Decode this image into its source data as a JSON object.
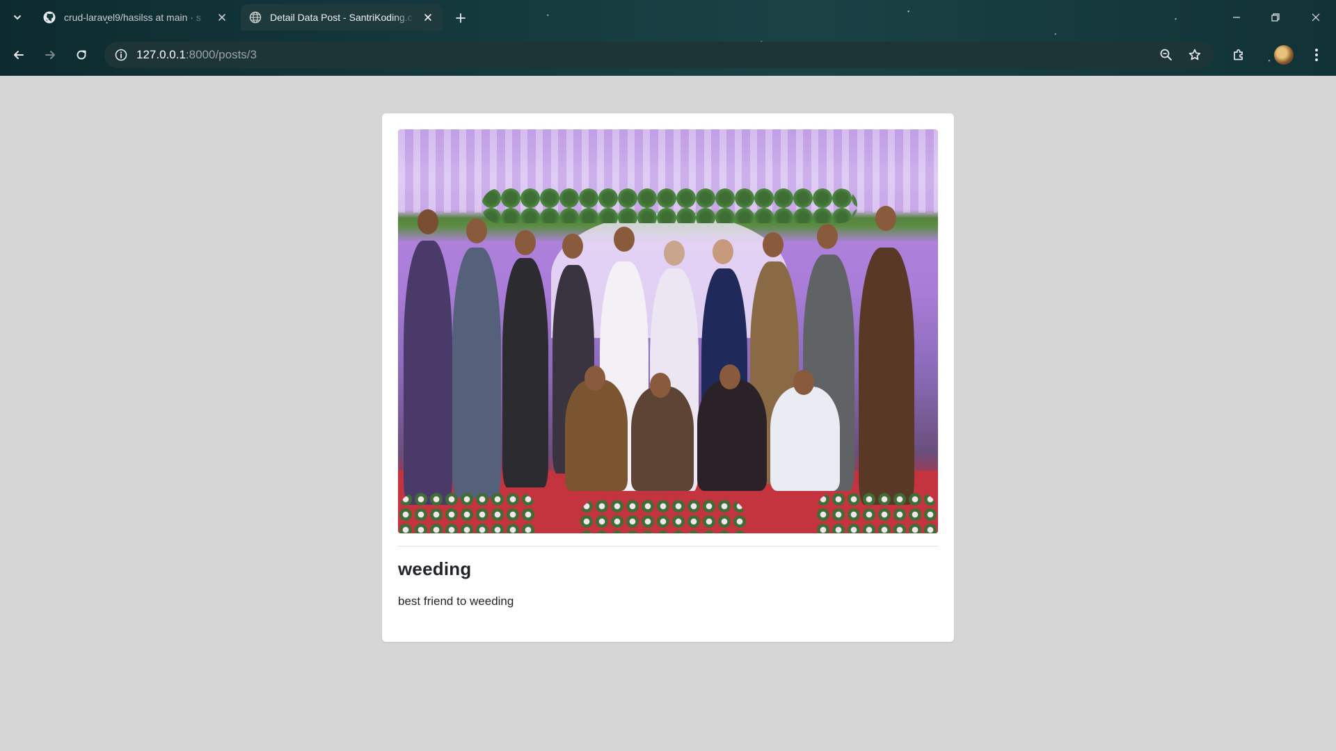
{
  "browser": {
    "tabs": [
      {
        "title": "crud-laravel9/hasilss at main · s",
        "favicon": "github-icon",
        "active": false
      },
      {
        "title": "Detail Data Post - SantriKoding.c",
        "favicon": "globe-icon",
        "active": true
      }
    ],
    "address": {
      "host": "127.0.0.1",
      "path": ":8000/posts/3"
    }
  },
  "post": {
    "image_alt": "Group photo at a wedding",
    "title": "weeding",
    "content": "best friend to weeding"
  },
  "colors": {
    "page_bg": "#d6d6d6",
    "card_bg": "#ffffff",
    "text": "#212529",
    "chrome_bg": "#14393d"
  }
}
